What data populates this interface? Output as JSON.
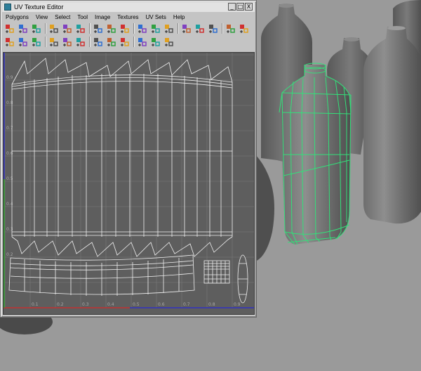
{
  "window": {
    "title": "UV Texture Editor",
    "controls": {
      "minimize": "_",
      "maximize": "□",
      "close": "X"
    }
  },
  "menu": [
    "Polygons",
    "View",
    "Select",
    "Tool",
    "Image",
    "Textures",
    "UV Sets",
    "Help"
  ],
  "toolbar": {
    "row1_icons": [
      "uv-select-icon",
      "move-uv-icon",
      "rotate-uv-icon",
      "flip-u-icon",
      "flip-v-icon",
      "cut-uv-icon",
      "sew-uv-icon",
      "layout-uv-icon",
      "align-uv-icon",
      "snap-uv-icon",
      "normalize-uv-icon",
      "grid-snap-icon",
      "distribute-uv-icon",
      "display-image-icon",
      "checker-icon",
      "grid-toggle-icon",
      "magnet-icon"
    ],
    "row2_icons": [
      "isolate-select-icon",
      "frame-selection-icon",
      "relax-uv-icon",
      "unfold-uv-icon",
      "smudge-uv-icon",
      "straighten-uv-icon",
      "merge-uv-icon",
      "shell-select-icon",
      "texture-borders-icon",
      "dim-image-icon",
      "filter-icon",
      "color-channel-icon"
    ]
  },
  "uv_grid": {
    "v_tick_labels": [
      "0.9",
      "0.8",
      "0.7",
      "0.6",
      "0.5",
      "0.4",
      "0.3",
      "0.2"
    ],
    "u_tick_labels": [
      "0.1",
      "0.2",
      "0.3",
      "0.4",
      "0.5",
      "0.6",
      "0.7",
      "0.8",
      "0.9"
    ]
  },
  "colors": {
    "grid_background": "#5e5e5e",
    "uv_wire": "#f2f2f2",
    "selected_wire": "#33e07a",
    "u_axis": "#c03030",
    "v_axis": "#3030c0",
    "w_axis": "#30a030"
  }
}
